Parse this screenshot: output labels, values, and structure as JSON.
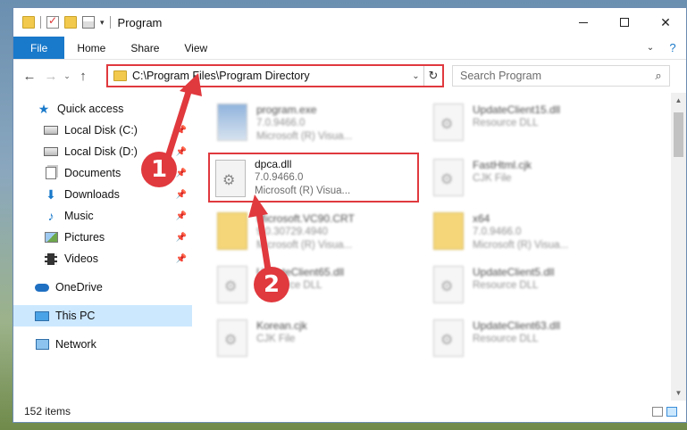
{
  "window": {
    "title": "Program"
  },
  "ribbon": {
    "tabs": [
      "File",
      "Home",
      "Share",
      "View"
    ]
  },
  "nav": {
    "address": "C:\\Program Files\\Program Directory",
    "search_placeholder": "Search Program"
  },
  "sidebar": {
    "items": [
      {
        "label": "Quick access",
        "icon": "star-icon",
        "pinned": false
      },
      {
        "label": "Local Disk (C:)",
        "icon": "drive-icon",
        "pinned": true
      },
      {
        "label": "Local Disk (D:)",
        "icon": "drive-icon",
        "pinned": true
      },
      {
        "label": "Documents",
        "icon": "documents-icon",
        "pinned": true
      },
      {
        "label": "Downloads",
        "icon": "downloads-icon",
        "pinned": true
      },
      {
        "label": "Music",
        "icon": "music-icon",
        "pinned": true
      },
      {
        "label": "Pictures",
        "icon": "pictures-icon",
        "pinned": true
      },
      {
        "label": "Videos",
        "icon": "videos-icon",
        "pinned": true
      },
      {
        "label": "OneDrive",
        "icon": "onedrive-icon",
        "pinned": false
      },
      {
        "label": "This PC",
        "icon": "this-pc-icon",
        "pinned": false
      },
      {
        "label": "Network",
        "icon": "network-icon",
        "pinned": false
      }
    ]
  },
  "files": [
    {
      "name": "program.exe",
      "line2": "7.0.9466.0",
      "line3": "Microsoft (R) Visua...",
      "type": "exe"
    },
    {
      "name": "UpdateClient15.dll",
      "line2": "Resource DLL",
      "line3": "",
      "type": "dll"
    },
    {
      "name": "dpca.dll",
      "line2": "7.0.9466.0",
      "line3": "Microsoft (R) Visua...",
      "type": "dll"
    },
    {
      "name": "FastHtml.cjk",
      "line2": "CJK File",
      "line3": "",
      "type": "dll"
    },
    {
      "name": "Microsoft.VC90.CRT",
      "line2": "9.0.30729.4940",
      "line3": "Microsoft (R) Visua...",
      "type": "folder"
    },
    {
      "name": "x64",
      "line2": "7.0.9466.0",
      "line3": "Microsoft (R) Visua...",
      "type": "folder"
    },
    {
      "name": "UpdateClient65.dll",
      "line2": "Resource DLL",
      "line3": "",
      "type": "dll"
    },
    {
      "name": "UpdateClient5.dll",
      "line2": "Resource DLL",
      "line3": "",
      "type": "dll"
    },
    {
      "name": "Korean.cjk",
      "line2": "CJK File",
      "line3": "",
      "type": "dll"
    },
    {
      "name": "UpdateClient63.dll",
      "line2": "Resource DLL",
      "line3": "",
      "type": "dll"
    }
  ],
  "status": {
    "count": "152 items"
  },
  "annotations": {
    "step1": "1",
    "step2": "2"
  },
  "colors": {
    "accent": "#1979ca",
    "highlight": "#e0393e"
  }
}
